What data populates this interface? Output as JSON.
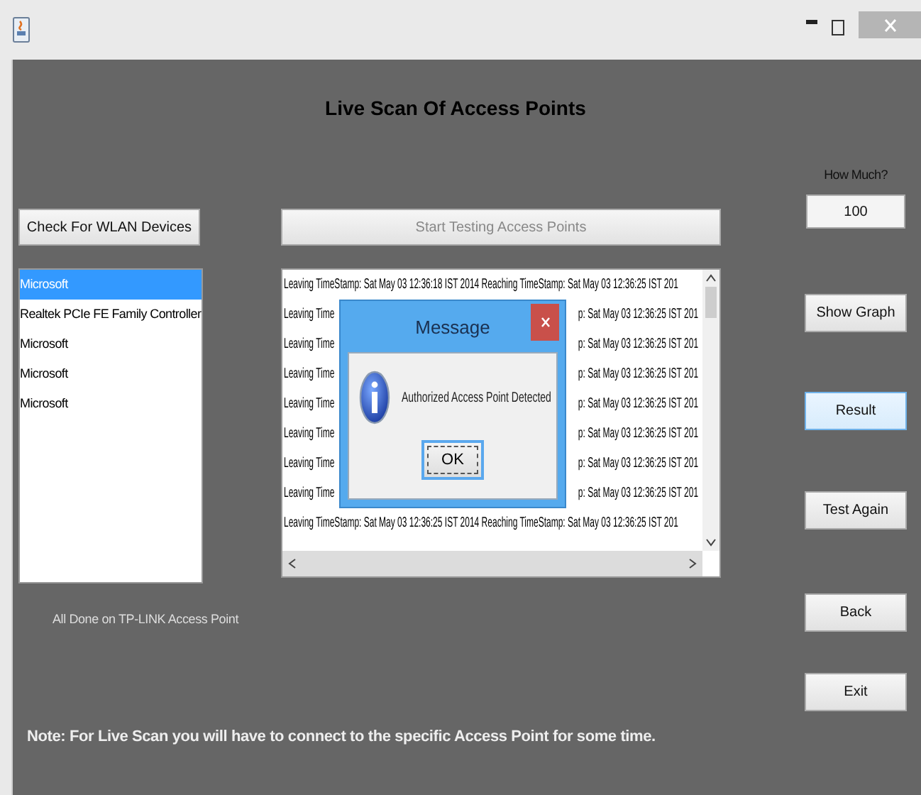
{
  "header": "Live Scan Of Access Points",
  "check_button": "Check For WLAN Devices",
  "start_button": {
    "label": "Start Testing Access Points",
    "disabled": true
  },
  "how_much": {
    "label": "How Much?",
    "value": "100"
  },
  "devices": [
    {
      "name": "Microsoft",
      "selected": true
    },
    {
      "name": "Realtek PCIe FE Family Controller",
      "selected": false
    },
    {
      "name": "Microsoft",
      "selected": false
    },
    {
      "name": "Microsoft",
      "selected": false
    },
    {
      "name": "Microsoft",
      "selected": false
    }
  ],
  "log_lines": [
    {
      "kind": "full",
      "text": "Leaving TimeStamp: Sat May 03 12:36:18 IST 2014 Reaching TimeStamp: Sat May 03 12:36:25 IST 201"
    },
    {
      "kind": "split",
      "left": "Leaving Time",
      "right": "p: Sat May 03 12:36:25 IST 201"
    },
    {
      "kind": "split",
      "left": "Leaving Time",
      "right": "p: Sat May 03 12:36:25 IST 201"
    },
    {
      "kind": "split",
      "left": "Leaving Time",
      "right": "p: Sat May 03 12:36:25 IST 201"
    },
    {
      "kind": "split",
      "left": "Leaving Time",
      "right": "p: Sat May 03 12:36:25 IST 201"
    },
    {
      "kind": "split",
      "left": "Leaving Time",
      "right": "p: Sat May 03 12:36:25 IST 201"
    },
    {
      "kind": "split",
      "left": "Leaving Time",
      "right": "p: Sat May 03 12:36:25 IST 201"
    },
    {
      "kind": "split",
      "left": "Leaving Time",
      "right": "p: Sat May 03 12:36:25 IST 201"
    },
    {
      "kind": "full",
      "text": "Leaving TimeStamp: Sat May 03 12:36:25 IST 2014 Reaching TimeStamp: Sat May 03 12:36:25 IST 201"
    }
  ],
  "status": "All Done on TP-LINK Access Point",
  "side_buttons": [
    {
      "label": "Show Graph",
      "focused": false
    },
    {
      "label": "Result",
      "focused": true
    },
    {
      "label": "Test Again",
      "focused": false
    },
    {
      "label": "Back",
      "focused": false
    },
    {
      "label": "Exit",
      "focused": false
    }
  ],
  "note": "Note: For Live Scan you will have to connect to the specific Access Point for some time.",
  "dialog": {
    "title": "Message",
    "message": "Authorized Access Point Detected",
    "button": "OK"
  }
}
